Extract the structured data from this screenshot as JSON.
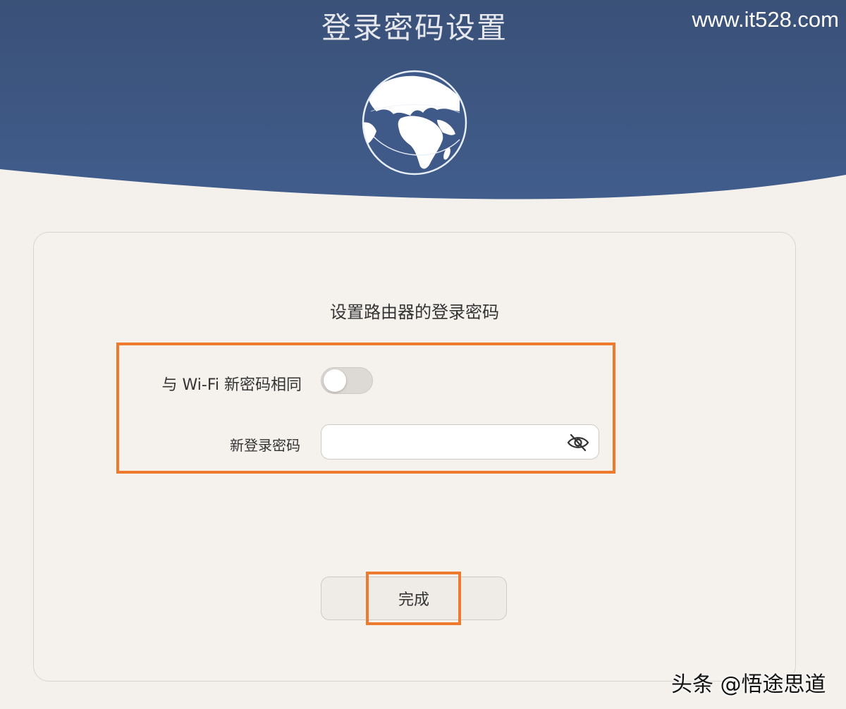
{
  "header": {
    "title": "登录密码设置",
    "watermark": "www.it528.com",
    "background_color": "#3d5784"
  },
  "card": {
    "heading": "设置路由器的登录密码",
    "toggle_row": {
      "label": "与 Wi-Fi 新密码相同",
      "checked": false
    },
    "password_row": {
      "label": "新登录密码",
      "value": "",
      "icon": "eye-slash-icon"
    },
    "done_label": "完成"
  },
  "highlight_color": "#ee7a2e",
  "footer_watermark": "头条 @悟途思道"
}
